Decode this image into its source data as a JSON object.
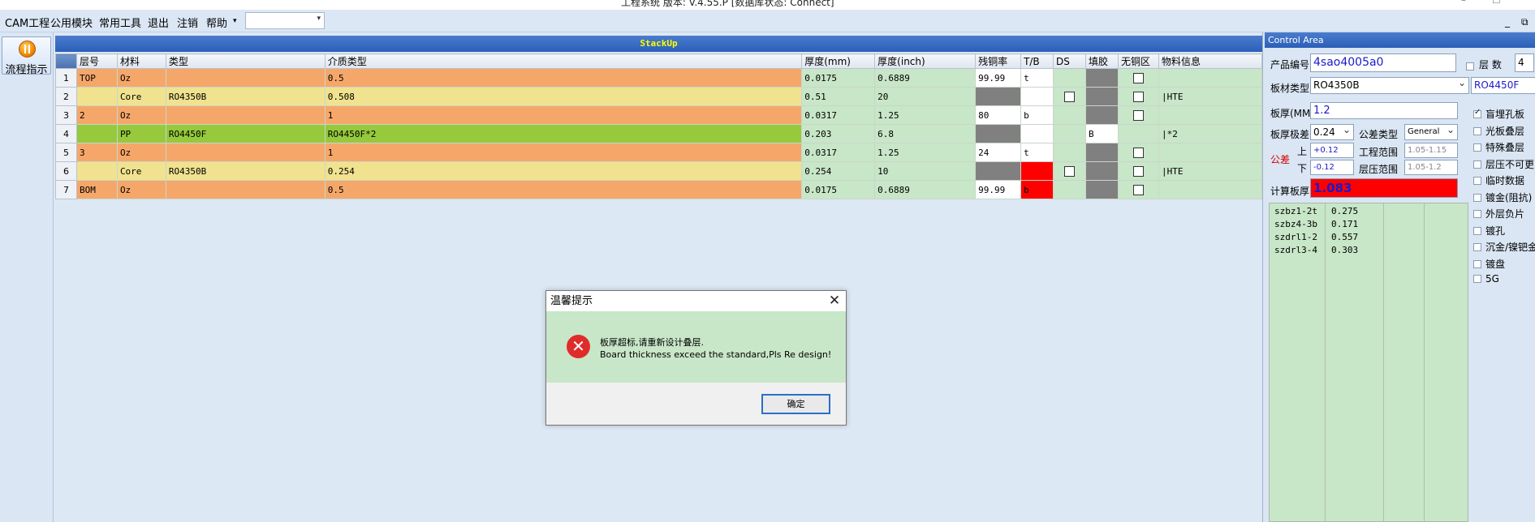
{
  "titlebar": {
    "text": "工程系统   版本: V.4.55.P   [数据库状态: Connect]",
    "min": "–",
    "max": "☐"
  },
  "menu": {
    "items": [
      "CAM工程",
      "公用模块",
      "常用工具",
      "退出",
      "注销",
      "帮助"
    ],
    "help_arrow": "▾",
    "combo_value": "",
    "combo_arrow": "▾",
    "right_min": "_",
    "right_restore": "⧉"
  },
  "left": {
    "flow_label": "流程指示"
  },
  "stackup": {
    "title": "StackUp",
    "columns": [
      "",
      "层号",
      "材料",
      "类型",
      "介质类型",
      "厚度(mm)",
      "厚度(inch)",
      "残铜率",
      "T/B",
      "DS",
      "填胶",
      "无铜区",
      "物料信息"
    ],
    "rows": [
      {
        "n": "1",
        "layer": "TOP",
        "mat": "Oz",
        "type": "",
        "med": "0.5",
        "mm": "0.0175",
        "inch": "0.6889",
        "cu": "99.99",
        "tb": "t",
        "fill": "",
        "info": "",
        "c": "o",
        "cuc": "white",
        "tbc": "white",
        "ds": false,
        "nocu": true
      },
      {
        "n": "2",
        "layer": "",
        "mat": "Core",
        "type": "RO4350B",
        "med": "0.508",
        "mm": "0.51",
        "inch": "20",
        "cu": "",
        "tb": "",
        "fill": "",
        "info": "|HTE",
        "c": "y",
        "cuc": "gray",
        "tbc": "white",
        "ds": true,
        "nocu": true
      },
      {
        "n": "3",
        "layer": "2",
        "mat": "Oz",
        "type": "",
        "med": "1",
        "mm": "0.0317",
        "inch": "1.25",
        "cu": "80",
        "tb": "b",
        "fill": "",
        "info": "",
        "c": "o",
        "cuc": "white",
        "tbc": "white",
        "ds": false,
        "nocu": true
      },
      {
        "n": "4",
        "layer": "",
        "mat": "PP",
        "type": "RO4450F",
        "med": "RO4450F*2",
        "mm": "0.203",
        "inch": "6.8",
        "cu": "",
        "tb": "",
        "fill": "B",
        "info": "|*2",
        "c": "g",
        "cuc": "gray",
        "tbc": "white",
        "ds": false,
        "nocu": false
      },
      {
        "n": "5",
        "layer": "3",
        "mat": "Oz",
        "type": "",
        "med": "1",
        "mm": "0.0317",
        "inch": "1.25",
        "cu": "24",
        "tb": "t",
        "fill": "",
        "info": "",
        "c": "o",
        "cuc": "white",
        "tbc": "white",
        "ds": false,
        "nocu": true
      },
      {
        "n": "6",
        "layer": "",
        "mat": "Core",
        "type": "RO4350B",
        "med": "0.254",
        "mm": "0.254",
        "inch": "10",
        "cu": "",
        "tb": "",
        "fill": "",
        "info": "|HTE",
        "c": "y",
        "cuc": "gray",
        "tbc": "red",
        "ds": true,
        "nocu": true
      },
      {
        "n": "7",
        "layer": "BOM",
        "mat": "Oz",
        "type": "",
        "med": "0.5",
        "mm": "0.0175",
        "inch": "0.6889",
        "cu": "99.99",
        "tb": "b",
        "fill": "",
        "info": "",
        "c": "o",
        "cuc": "white",
        "tbc": "red",
        "ds": false,
        "nocu": true
      }
    ]
  },
  "colors": {
    "o": "#f5a76a",
    "y": "#f0e28f",
    "g": "#96c93c",
    "accent": "#2b5fb8"
  },
  "control": {
    "title": "Control Area",
    "product_label": "产品编号",
    "product_value": "4sao4005a0",
    "layers_label": "层  数",
    "layers_value": "4",
    "board_type_label": "板材类型",
    "board_type_value": "RO4350B",
    "board_type_value2": "RO4450F",
    "thickness_label": "板厚(MM)",
    "thickness_value": "1.2",
    "tol_label": "板厚极差",
    "tol_value": "0.24",
    "tol_type_label": "公差类型",
    "tol_type_value": "General",
    "tol_word": "公差",
    "upper_label": "上",
    "lower_label": "下",
    "upper_value": "+0.12",
    "lower_value": "-0.12",
    "eng_range_label": "工程范围",
    "eng_range_value": "1.05-1.15",
    "press_range_label": "层压范围",
    "press_range_value": "1.05-1.2",
    "calc_label": "计算板厚",
    "calc_value": "1.083",
    "options": [
      {
        "label": "盲埋孔板",
        "checked": true
      },
      {
        "label": "光板叠层",
        "checked": false
      },
      {
        "label": "特殊叠层",
        "checked": false
      },
      {
        "label": "层压不可更",
        "checked": false
      },
      {
        "label": "临时数据",
        "checked": false
      },
      {
        "label": "镀金(阻抗)",
        "checked": false
      },
      {
        "label": "外层负片",
        "checked": false
      },
      {
        "label": "镀孔",
        "checked": false
      },
      {
        "label": "沉金/镍钯金",
        "checked": false
      },
      {
        "label": "镀盘",
        "checked": false
      },
      {
        "label": "5G",
        "checked": false
      }
    ],
    "thickness_list": [
      {
        "name": "szbz1-2t",
        "value": "0.275"
      },
      {
        "name": "szbz4-3b",
        "value": "0.171"
      },
      {
        "name": "szdrl1-2",
        "value": "0.557"
      },
      {
        "name": "szdrl3-4",
        "value": "0.303"
      }
    ]
  },
  "dialog": {
    "title": "温馨提示",
    "close": "✕",
    "icon": "✕",
    "message_cn": "板厚超标,请重新设计叠层.",
    "message_en": "Board thickness exceed the standard,Pls Re design!",
    "ok": "确定"
  }
}
